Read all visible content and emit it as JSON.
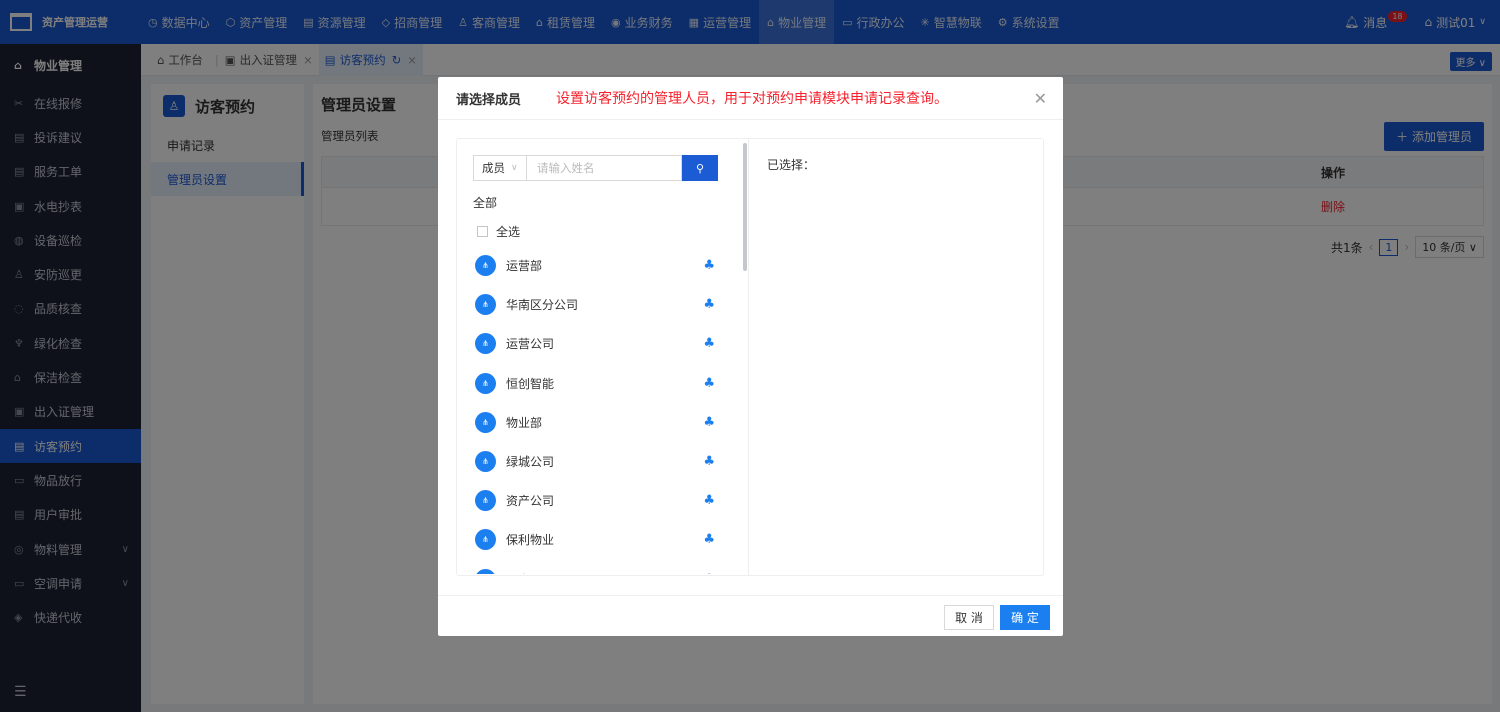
{
  "app": {
    "title": "资产管理运营"
  },
  "topnav": [
    {
      "label": "数据中心",
      "icon": "dashboard-icon"
    },
    {
      "label": "资产管理",
      "icon": "cube-icon"
    },
    {
      "label": "资源管理",
      "icon": "building-icon"
    },
    {
      "label": "招商管理",
      "icon": "diamond-icon"
    },
    {
      "label": "客商管理",
      "icon": "users-icon"
    },
    {
      "label": "租赁管理",
      "icon": "house-icon"
    },
    {
      "label": "业务财务",
      "icon": "coin-icon"
    },
    {
      "label": "运营管理",
      "icon": "chart-icon"
    },
    {
      "label": "物业管理",
      "icon": "home-icon",
      "active": true
    },
    {
      "label": "行政办公",
      "icon": "monitor-icon"
    },
    {
      "label": "智慧物联",
      "icon": "iot-icon"
    },
    {
      "label": "系统设置",
      "icon": "gear-icon"
    }
  ],
  "header": {
    "messages_label": "消息",
    "messages_count": "18",
    "user": "测试01"
  },
  "sidebar": {
    "title": "物业管理",
    "items": [
      {
        "label": "在线报修"
      },
      {
        "label": "投诉建议"
      },
      {
        "label": "服务工单"
      },
      {
        "label": "水电抄表"
      },
      {
        "label": "设备巡检"
      },
      {
        "label": "安防巡更"
      },
      {
        "label": "品质核查"
      },
      {
        "label": "绿化检查"
      },
      {
        "label": "保洁检查"
      },
      {
        "label": "出入证管理"
      },
      {
        "label": "访客预约",
        "active": true
      },
      {
        "label": "物品放行"
      },
      {
        "label": "用户审批"
      },
      {
        "label": "物料管理",
        "expandable": true
      },
      {
        "label": "空调申请",
        "expandable": true
      },
      {
        "label": "快递代收"
      }
    ]
  },
  "tabs": [
    {
      "label": "工作台"
    },
    {
      "label": "出入证管理"
    },
    {
      "label": "访客预约",
      "active": true
    }
  ],
  "more_label": "更多",
  "left_panel": {
    "title": "访客预约",
    "items": [
      {
        "label": "申请记录"
      },
      {
        "label": "管理员设置",
        "active": true
      }
    ]
  },
  "main": {
    "title": "管理员设置",
    "subtitle": "管理员列表",
    "add_button": "添加管理员",
    "table": {
      "header_op": "操作",
      "row_op": "删除"
    },
    "pager": {
      "total": "共1条",
      "page": "1",
      "size": "10 条/页"
    }
  },
  "modal": {
    "title": "请选择成员",
    "note": "设置访客预约的管理人员，用于对预约申请模块申请记录查询。",
    "search": {
      "scope": "成员",
      "placeholder": "请输入姓名"
    },
    "all_label": "全部",
    "select_all": "全选",
    "selected_label": "已选择：",
    "list": [
      "运营部",
      "华南区分公司",
      "运营公司",
      "恒创智能",
      "物业部",
      "绿城公司",
      "资产公司",
      "保利物业",
      "罗青"
    ],
    "cancel": "取 消",
    "confirm": "确 定"
  }
}
